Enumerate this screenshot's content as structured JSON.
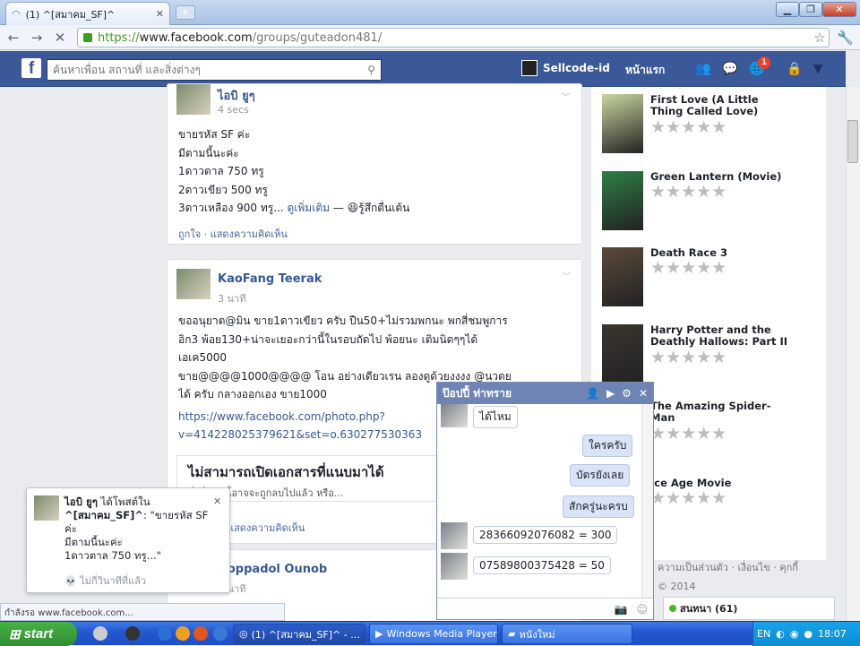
{
  "browser": {
    "tab_title": "(1) ^[สมาคม_SF]^",
    "url_scheme": "https://",
    "url_host": "www.facebook.com",
    "url_path": "/groups/guteadon481/",
    "new_tab": "+",
    "status_text": "กำลังรอ www.facebook.com..."
  },
  "fb": {
    "logo": "f",
    "search_placeholder": "ค้นหาเพื่อน สถานที่ และสิ่งต่างๆ",
    "user_name": "Sellcode-id",
    "home_label": "หน้าแรก",
    "notification_count": "1"
  },
  "posts": [
    {
      "author": "ไอบิ ยูๆ",
      "time": "4 secs",
      "lines": [
        "ขายรหัส SF ค่ะ",
        "มีตามนี้นะค่ะ",
        "1ดาวตาล 750 ทรู",
        "2ดาวเขียว 500 ทรู"
      ],
      "last_line": "3ดาวเหลือง 900 ทรู...",
      "see_more": "ดูเพิ่มเติม",
      "feeling": "— 😆รู้สึกตื่นเต้น",
      "footer": "ถูกใจ · แสดงความคิดเห็น"
    },
    {
      "author": "KaoFang Teerak",
      "time": "3 นาที",
      "lines": [
        "ขออนุยาต@มิน ขาย1ดาวเขียว ครับ ปืน50+ไม่รวมพกนะ พกสี่ชมพูการ",
        "อิก3 พ้อย130+น่าจะเยอะกว่านี้ในรอบถัดไป พ้อยนะ เติมนิดๆๆได้",
        "เอเค5000",
        "ขาย@@@@1000@@@@ โอน อย่างเดียวเรน ลองดูด้วยงงงง @นวตย",
        "ได้ ครับ กลางออกเอง ขาย1000"
      ],
      "link": "https://www.facebook.com/photo.php?",
      "link2": "v=414228025379621&set=o.630277530363",
      "attach_title": "ไม่สามารถเปิดเอกสารที่แนบมาได้",
      "attach_sub": "สิ่งที่แนบนี้อาจจะถูกลบไปแล้ว หรือ...",
      "footer": "· แสดงความคิดเห็น"
    },
    {
      "author": "Noppadol Ounob",
      "time": "4 นาที"
    }
  ],
  "movies": [
    {
      "title": "First Love (A Little Thing Called Love)",
      "stars": "★★★★★",
      "color": "#c9d7a0"
    },
    {
      "title": "Green Lantern (Movie)",
      "stars": "★★★★★",
      "color": "#2f7f45"
    },
    {
      "title": "Death Race 3",
      "stars": "★★★★★",
      "color": "#5b4a3a"
    },
    {
      "title": "Harry Potter and the Deathly Hallows: Part II",
      "stars": "★★★★★",
      "color": "#3a3530"
    },
    {
      "title": "The Amazing Spider-Man",
      "stars": "★★★★★",
      "color": "#7a1f22"
    },
    {
      "title": "Ice Age Movie",
      "stars": "★★★★★",
      "color": "#8fb4d4"
    }
  ],
  "right_footer": "ความเป็นส่วนตัว · เงื่อนไข · คุกกี้",
  "right_footer2": "© 2014",
  "chat_status": "สนทนา (61)",
  "chat": {
    "title": "ป๊อปปี้ ท่าทราย",
    "messages": [
      {
        "text": "ได้ไหม",
        "mine": false
      },
      {
        "text": "ใครครับ",
        "mine": true
      },
      {
        "text": "บัตรยังเลย",
        "mine": true
      },
      {
        "text": "สักครู่นะครบ",
        "mine": true
      },
      {
        "text": "28366092076082 = 300",
        "mine": false
      },
      {
        "text": "07589800375428 = 50",
        "mine": false
      }
    ]
  },
  "popup": {
    "author": "ไอบิ ยูๆ",
    "action": " ได้โพสต์ใน",
    "group": "^[สมาคม_SF]^",
    "excerpt": ": \"ขายรหัส SF ค่ะ",
    "line2": "มีตามนี้นะค่ะ",
    "line3": "1ดาวตาล 750 ทรู...\"",
    "ago": "ไม่กี่วินาทีที่แล้ว",
    "close": "✕"
  },
  "taskbar": {
    "start": "start",
    "buttons": [
      "(1) ^[สมาคม_SF]^ - ...",
      "Windows Media Player",
      "หนังใหม่"
    ],
    "lang": "EN",
    "clock": "18:07"
  }
}
